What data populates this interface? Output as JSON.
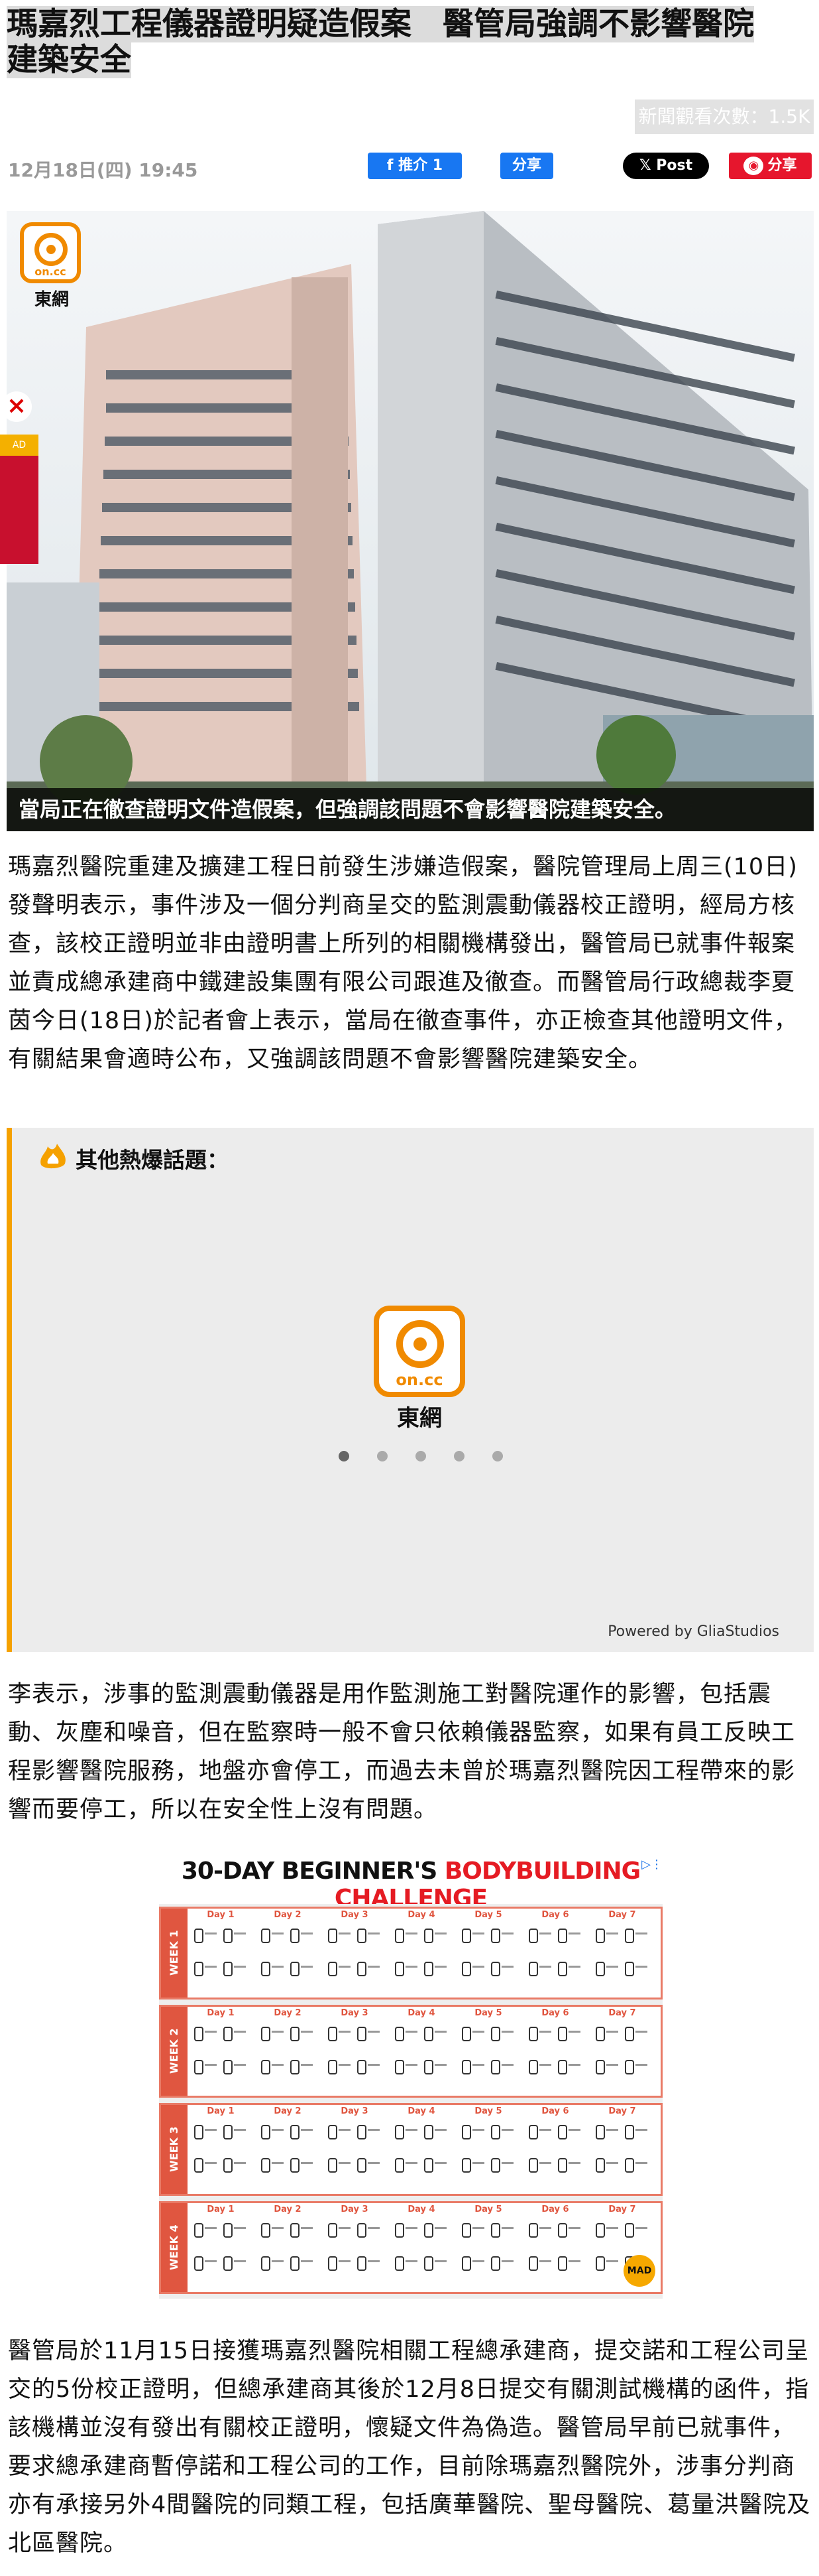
{
  "article": {
    "title_line1": "瑪嘉烈工程儀器證明疑造假案　醫管局強調不影響醫院",
    "title_line2": "建築安全",
    "views": "新聞觀看次數：1.5K",
    "date": "12月18日(四) 19:45"
  },
  "share": {
    "fb_like": "推介 1",
    "fb_share": "分享",
    "x_post": "Post",
    "weibo": "分享"
  },
  "hero": {
    "logo_text": "on.cc",
    "logo_label": "東網",
    "caption": "當局正在徹查證明文件造假案，但強調該問題不會影響醫院建築安全。"
  },
  "side_ad": {
    "label": "AD"
  },
  "paragraphs": {
    "p1": "瑪嘉烈醫院重建及擴建工程日前發生涉嫌造假案，醫院管理局上周三(10日)發聲明表示，事件涉及一個分判商呈交的監測震動儀器校正證明，經局方核查，該校正證明並非由證明書上所列的相關機構發出，醫管局已就事件報案並責成總承建商中鐵建設集團有限公司跟進及徹查。而醫管局行政總裁李夏茵今日(18日)於記者會上表示，當局在徹查事件，亦正檢查其他證明文件，有關結果會適時公布，又強調該問題不會影響醫院建築安全。",
    "p2": "李表示，涉事的監測震動儀器是用作監測施工對醫院運作的影響，包括震動、灰塵和噪音，但在監察時一般不會只依賴儀器監察，如果有員工反映工程影響醫院服務，地盤亦會停工，而過去未曾於瑪嘉烈醫院因工程帶來的影響而要停工，所以在安全性上沒有問題。",
    "p3": "醫管局於11月15日接獲瑪嘉烈醫院相關工程總承建商，提交諾和工程公司呈交的5份校正證明，但總承建商其後於12月8日提交有關測試機構的函件，指該機構並沒有發出有關校正證明，懷疑文件為偽造。醫管局早前已就事件，要求總承建商暫停諾和工程公司的工作，目前除瑪嘉烈醫院外，涉事分判商亦有承接另外4間醫院的同類工程，包括廣華醫院、聖母醫院、葛量洪醫院及北區醫院。"
  },
  "hot_topics": {
    "title": "其他熱爆話題：",
    "logo_text": "on.cc",
    "logo_label": "東網",
    "powered_by": "Powered by GliaStudios"
  },
  "ad": {
    "title_black": "30-DAY BEGINNER'S ",
    "title_red": "BODYBUILDING CHALLENGE",
    "weeks": [
      "WEEK 1",
      "WEEK 2",
      "WEEK 3",
      "WEEK 4"
    ],
    "days": [
      "Day 1",
      "Day 2",
      "Day 3",
      "Day 4",
      "Day 5",
      "Day 6",
      "Day 7"
    ],
    "brand": "MAD"
  }
}
